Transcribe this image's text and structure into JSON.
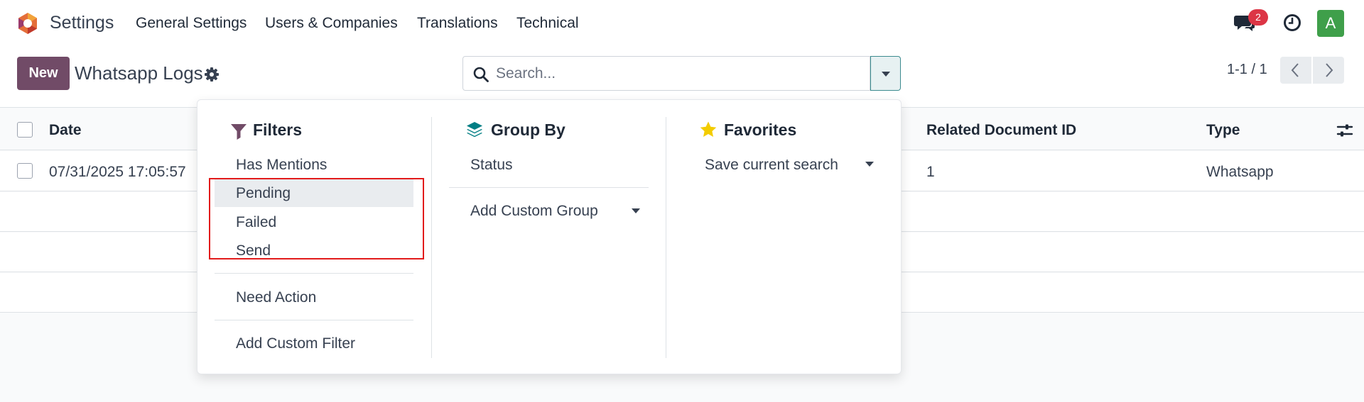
{
  "navbar": {
    "app_name": "Settings",
    "menu": [
      "General Settings",
      "Users & Companies",
      "Translations",
      "Technical"
    ],
    "chat_badge": "2",
    "avatar_initial": "A"
  },
  "control_panel": {
    "new_label": "New",
    "title": "Whatsapp Logs",
    "search_placeholder": "Search...",
    "pager": "1-1 / 1"
  },
  "list": {
    "columns": [
      "Date",
      "Related Document ID",
      "Type"
    ],
    "rows": [
      {
        "date": "07/31/2025 17:05:57",
        "related_document_id": "1",
        "type": "Whatsapp"
      }
    ]
  },
  "search_panel": {
    "filters": {
      "heading": "Filters",
      "items": [
        "Has Mentions",
        "Pending",
        "Failed",
        "Send",
        "Need Action",
        "Add Custom Filter"
      ],
      "highlighted_item": "Pending"
    },
    "group_by": {
      "heading": "Group By",
      "items": [
        "Status",
        "Add Custom Group"
      ]
    },
    "favorites": {
      "heading": "Favorites",
      "items": [
        "Save current search"
      ]
    }
  },
  "colors": {
    "brand": "#714b67",
    "badge": "#dc3545",
    "avatar": "#3f9f4a",
    "highlight_box": "#e21b1b",
    "teal": "#017e84",
    "star": "#f3cc00"
  }
}
